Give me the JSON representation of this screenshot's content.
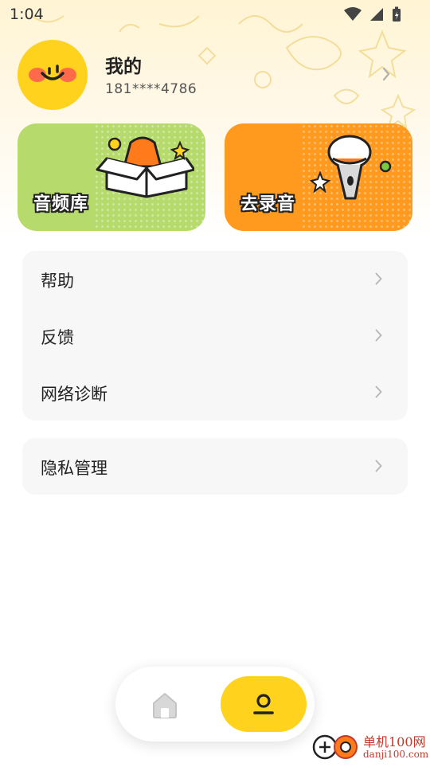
{
  "status_bar": {
    "time": "1:04"
  },
  "profile": {
    "name": "我的",
    "phone": "181****4786"
  },
  "cards": {
    "library_label": "音频库",
    "record_label": "去录音"
  },
  "menu": {
    "group1": [
      {
        "label": "帮助"
      },
      {
        "label": "反馈"
      },
      {
        "label": "网络诊断"
      }
    ],
    "group2": [
      {
        "label": "隐私管理"
      }
    ]
  },
  "watermark": {
    "title": "单机100网",
    "url": "danji100.com"
  },
  "colors": {
    "accent_yellow": "#ffd21e",
    "library_green": "#b6db6c",
    "record_orange": "#ff9a1f"
  },
  "icons": {
    "home": "home-icon",
    "profile": "user-icon",
    "chevron": "chevron-right-icon"
  }
}
